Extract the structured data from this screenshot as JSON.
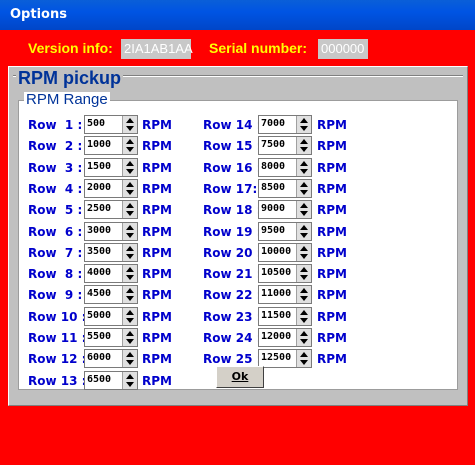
{
  "window": {
    "title": "Options"
  },
  "info": {
    "version_label": "Version info:",
    "version_value": "2IA1AB1AA",
    "serial_label": "Serial number:",
    "serial_value": "000000"
  },
  "rpm_pickup": {
    "title": "RPM pickup",
    "range_title": "RPM Range",
    "unit": "RPM",
    "rows_left": [
      {
        "label": "Row  1 :",
        "value": "500"
      },
      {
        "label": "Row  2 :",
        "value": "1000"
      },
      {
        "label": "Row  3 :",
        "value": "1500"
      },
      {
        "label": "Row  4 :",
        "value": "2000"
      },
      {
        "label": "Row  5 :",
        "value": "2500"
      },
      {
        "label": "Row  6 :",
        "value": "3000"
      },
      {
        "label": "Row  7 :",
        "value": "3500"
      },
      {
        "label": "Row  8 :",
        "value": "4000"
      },
      {
        "label": "Row  9 :",
        "value": "4500"
      },
      {
        "label": "Row 10 :",
        "value": "5000"
      },
      {
        "label": "Row 11 :",
        "value": "5500"
      },
      {
        "label": "Row 12 :",
        "value": "6000"
      },
      {
        "label": "Row 13 :",
        "value": "6500"
      }
    ],
    "rows_right": [
      {
        "label": "Row 14 :",
        "value": "7000"
      },
      {
        "label": "Row 15 :",
        "value": "7500"
      },
      {
        "label": "Row 16 :",
        "value": "8000"
      },
      {
        "label": "Row 17:",
        "value": "8500"
      },
      {
        "label": "Row 18 :",
        "value": "9000"
      },
      {
        "label": "Row 19 :",
        "value": "9500"
      },
      {
        "label": "Row 20 :",
        "value": "10000"
      },
      {
        "label": "Row 21 :",
        "value": "10500"
      },
      {
        "label": "Row 22 :",
        "value": "11000"
      },
      {
        "label": "Row 23 :",
        "value": "11500"
      },
      {
        "label": "Row 24 :",
        "value": "12000"
      },
      {
        "label": "Row 25 :",
        "value": "12500"
      }
    ]
  },
  "ok_button": {
    "label": "Ok"
  },
  "colors": {
    "background": "#ff0000",
    "accent_text": "#ffff00",
    "label_text": "#0000cc",
    "titlebar": "#0054e3"
  }
}
